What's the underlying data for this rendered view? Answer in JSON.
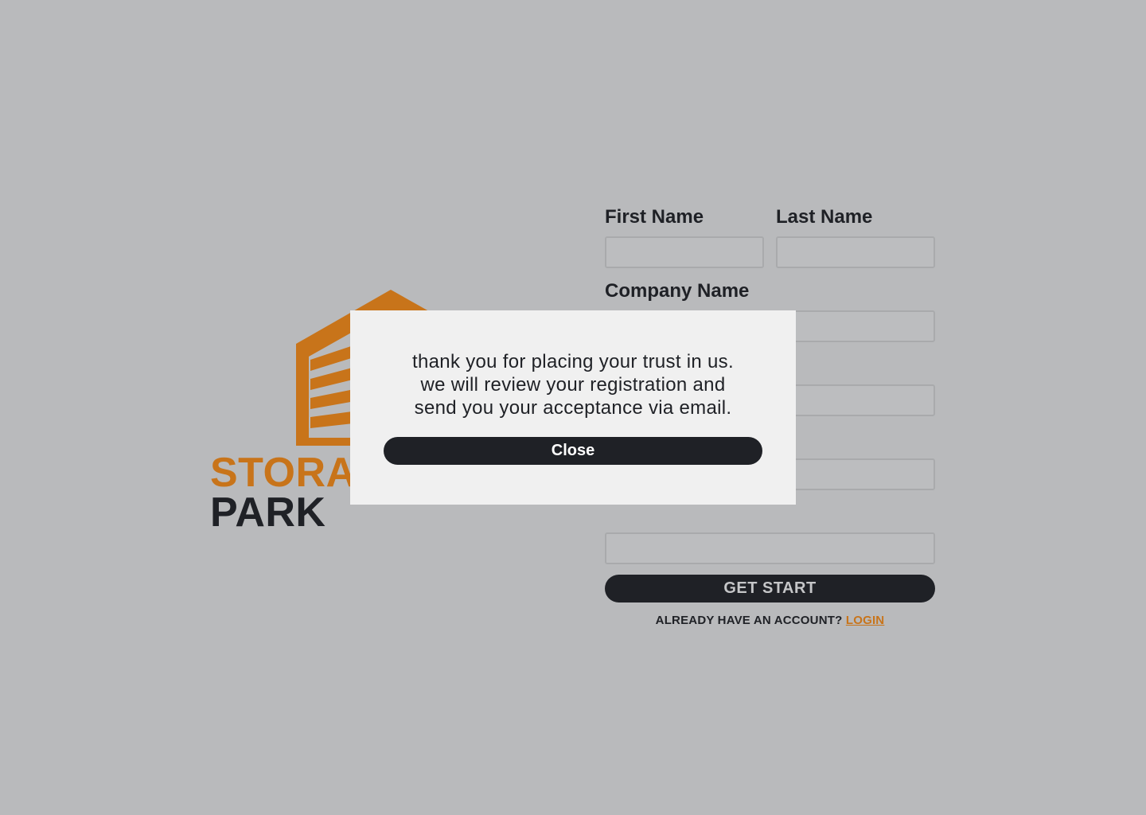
{
  "brand": {
    "word_top": "STORAGE",
    "word_bottom": "PARK",
    "accent_color": "#c8741a",
    "dark_color": "#1f2126",
    "logo_icon": "warehouse-building-icon"
  },
  "form": {
    "first_name_label": "First Name",
    "first_name_value": "",
    "last_name_label": "Last Name",
    "last_name_value": "",
    "company_name_label": "Company Name",
    "company_name_value": "",
    "field_3_value": "",
    "field_4_value": "",
    "field_5_value": "",
    "submit_label": "GET START",
    "account_prompt": "ALREADY HAVE AN ACCOUNT?",
    "login_link": "LOGIN"
  },
  "modal": {
    "message": "thank you for placing your trust in us.\nwe will review your registration and\nsend you your  acceptance via email.",
    "close_label": "Close"
  },
  "colors": {
    "overlay_background": "#b9babc",
    "modal_background": "#f0f0f0"
  }
}
